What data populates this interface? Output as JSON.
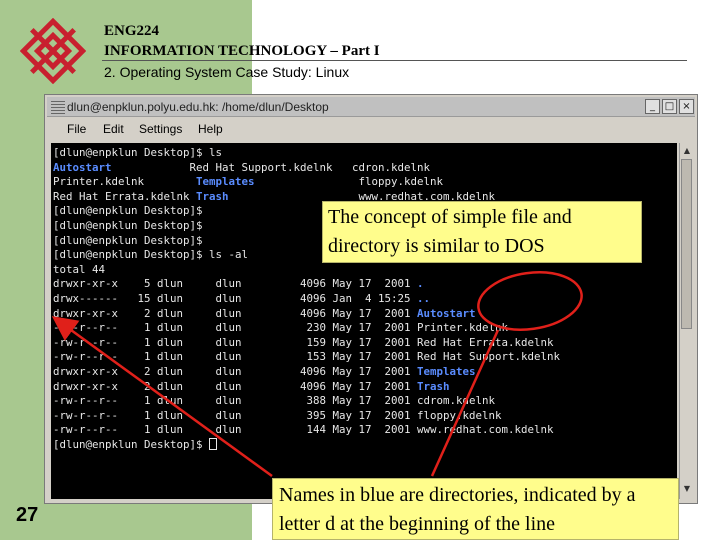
{
  "header": {
    "line1": "ENG224",
    "line2": "INFORMATION TECHNOLOGY – Part I",
    "line3": "2. Operating System Case Study: Linux"
  },
  "page_number": "27",
  "logo": {
    "icon": "polyu-logo-icon",
    "color": "#c8202f"
  },
  "window": {
    "title": "dlun@enpklun.polyu.edu.hk: /home/dlun/Desktop",
    "buttons": {
      "minimize": "_",
      "maximize": "□",
      "close": "×"
    },
    "menu": [
      "File",
      "Edit",
      "Settings",
      "Help"
    ]
  },
  "terminal": {
    "line_01": "[dlun@enpklun Desktop]$ ls",
    "line_02_a": "Autostart",
    "line_02_b": "            Red Hat Support.kdelnk   cdron.kdelnk",
    "line_03_a": "Printer.kdelnk        ",
    "line_03_b": "Templates",
    "line_03_c": "                floppy.kdelnk",
    "line_04_a": "Red Hat Errata.kdelnk ",
    "line_04_b": "Trash",
    "line_04_c": "                    www.redhat.com.kdelnk",
    "line_05": "[dlun@enpklun Desktop]$",
    "line_06": "[dlun@enpklun Desktop]$",
    "line_07": "[dlun@enpklun Desktop]$",
    "line_08": "[dlun@enpklun Desktop]$ ls -al",
    "line_09": "total 44",
    "rows": [
      {
        "perm": "drwxr-xr-x",
        "links": " 5",
        "user": "dlun",
        "group": "dlun",
        "size": "4096",
        "date": "May 17  2001",
        "name": ".",
        "dir": true
      },
      {
        "perm": "drwx------",
        "links": "15",
        "user": "dlun",
        "group": "dlun",
        "size": "4096",
        "date": "Jan  4 15:25",
        "name": "..",
        "dir": true
      },
      {
        "perm": "drwxr-xr-x",
        "links": " 2",
        "user": "dlun",
        "group": "dlun",
        "size": "4096",
        "date": "May 17  2001",
        "name": "Autostart",
        "dir": true
      },
      {
        "perm": "-rw-r--r--",
        "links": " 1",
        "user": "dlun",
        "group": "dlun",
        "size": " 230",
        "date": "May 17  2001",
        "name": "Printer.kdelnk",
        "dir": false
      },
      {
        "perm": "-rw-r--r--",
        "links": " 1",
        "user": "dlun",
        "group": "dlun",
        "size": " 159",
        "date": "May 17  2001",
        "name": "Red Hat Errata.kdelnk",
        "dir": false
      },
      {
        "perm": "-rw-r--r--",
        "links": " 1",
        "user": "dlun",
        "group": "dlun",
        "size": " 153",
        "date": "May 17  2001",
        "name": "Red Hat Support.kdelnk",
        "dir": false
      },
      {
        "perm": "drwxr-xr-x",
        "links": " 2",
        "user": "dlun",
        "group": "dlun",
        "size": "4096",
        "date": "May 17  2001",
        "name": "Templates",
        "dir": true
      },
      {
        "perm": "drwxr-xr-x",
        "links": " 2",
        "user": "dlun",
        "group": "dlun",
        "size": "4096",
        "date": "May 17  2001",
        "name": "Trash",
        "dir": true
      },
      {
        "perm": "-rw-r--r--",
        "links": " 1",
        "user": "dlun",
        "group": "dlun",
        "size": " 388",
        "date": "May 17  2001",
        "name": "cdrom.kdelnk",
        "dir": false
      },
      {
        "perm": "-rw-r--r--",
        "links": " 1",
        "user": "dlun",
        "group": "dlun",
        "size": " 395",
        "date": "May 17  2001",
        "name": "floppy.kdelnk",
        "dir": false
      },
      {
        "perm": "-rw-r--r--",
        "links": " 1",
        "user": "dlun",
        "group": "dlun",
        "size": " 144",
        "date": "May 17  2001",
        "name": "www.redhat.com.kdelnk",
        "dir": false
      }
    ],
    "last_prompt": "[dlun@enpklun Desktop]$ ",
    "colors": {
      "background": "#000000",
      "text": "#e8e8e8",
      "directory": "#5a8cff"
    }
  },
  "callouts": {
    "top": "The concept of simple file and directory is similar to DOS",
    "bottom": "Names in blue are directories, indicated by a letter d at the beginning of the line",
    "color": "#fffd8c",
    "arrow_color": "#e0201a"
  }
}
